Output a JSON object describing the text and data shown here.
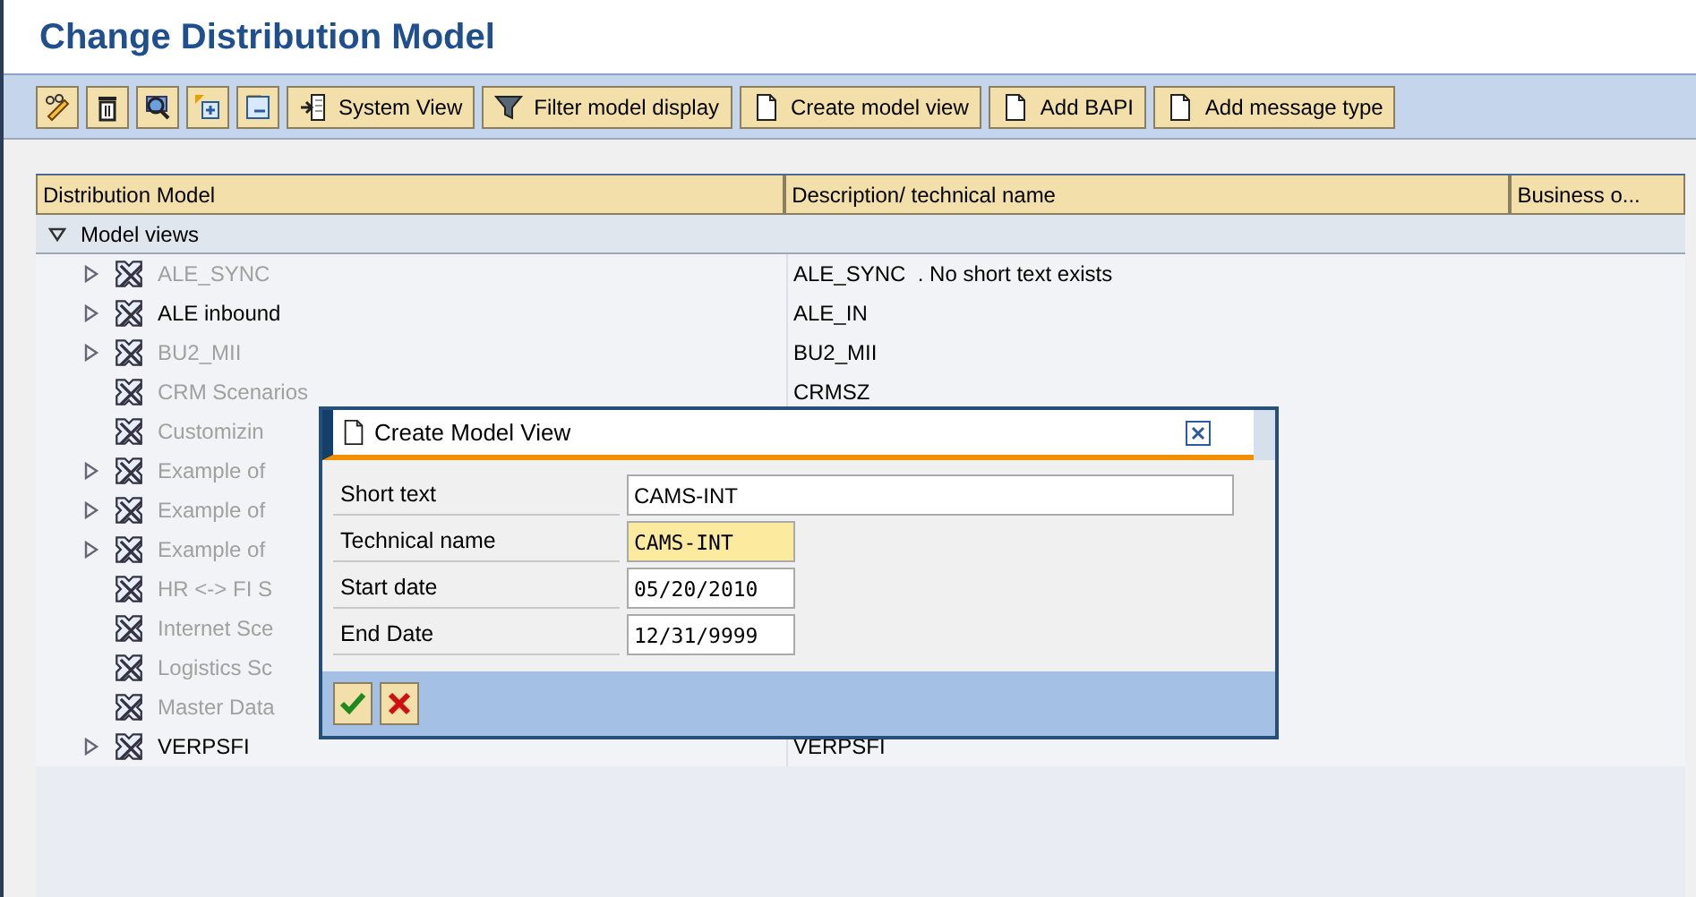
{
  "window": {
    "title": "Change Distribution Model"
  },
  "toolbar": {
    "buttons": [
      {
        "kind": "edit"
      },
      {
        "kind": "delete"
      },
      {
        "kind": "find"
      },
      {
        "kind": "expand"
      },
      {
        "kind": "collapse"
      },
      {
        "label": "System View",
        "kind": "system"
      },
      {
        "label": "Filter model display",
        "kind": "filter"
      },
      {
        "label": "Create model view",
        "kind": "page"
      },
      {
        "label": "Add BAPI",
        "kind": "page"
      },
      {
        "label": "Add message type",
        "kind": "page"
      }
    ]
  },
  "tree": {
    "columns": [
      "Distribution Model",
      "Description/ technical name",
      "Business o..."
    ],
    "root": {
      "label": "Model views",
      "expanded": true,
      "children": [
        {
          "label": "ALE_SYNC",
          "description": "ALE_SYNC  . No short text exists",
          "expandable": true,
          "active": false
        },
        {
          "label": "ALE inbound",
          "description": "ALE_IN",
          "expandable": true,
          "active": true
        },
        {
          "label": "BU2_MII",
          "description": "BU2_MII",
          "expandable": true,
          "active": false
        },
        {
          "label": "CRM Scenarios",
          "description": "CRMSZ",
          "expandable": false,
          "active": false
        },
        {
          "label": "Customizin",
          "expandable": false,
          "active": false
        },
        {
          "label": "Example of",
          "expandable": true,
          "active": false
        },
        {
          "label": "Example of",
          "expandable": true,
          "active": false
        },
        {
          "label": "Example of",
          "expandable": true,
          "active": false
        },
        {
          "label": "HR <-> FI S",
          "expandable": false,
          "active": false
        },
        {
          "label": "Internet Sce",
          "expandable": false,
          "active": false
        },
        {
          "label": "Logistics Sc",
          "expandable": false,
          "active": false
        },
        {
          "label": "Master Data",
          "expandable": false,
          "active": false
        },
        {
          "label": "VERPSFI",
          "description": "VERPSFI",
          "expandable": true,
          "active": true
        }
      ]
    }
  },
  "dialog": {
    "title": "Create Model View",
    "fields": [
      {
        "label": "Short text",
        "value": "CAMS-INT",
        "kind": "wide",
        "focused": false
      },
      {
        "label": "Technical name",
        "value": "CAMS-INT",
        "kind": "mono",
        "focused": true
      },
      {
        "label": "Start date",
        "value": "05/20/2010",
        "kind": "mono",
        "focused": false
      },
      {
        "label": "End Date",
        "value": "12/31/9999",
        "kind": "mono",
        "focused": false
      }
    ],
    "buttons": [
      {
        "kind": "confirm"
      },
      {
        "kind": "cancel"
      }
    ]
  }
}
